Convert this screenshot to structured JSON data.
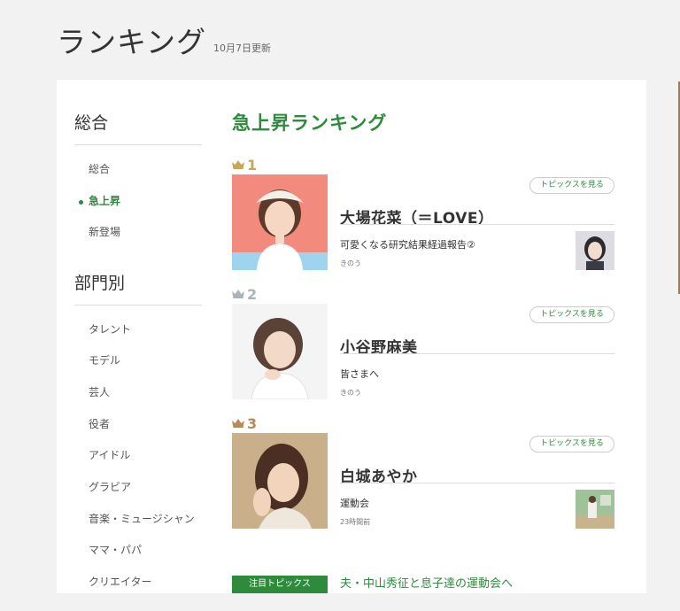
{
  "header": {
    "title": "ランキング",
    "updated": "10月7日更新"
  },
  "sidebar": {
    "overall_heading": "総合",
    "overall_items": [
      {
        "label": "総合",
        "active": false
      },
      {
        "label": "急上昇",
        "active": true
      },
      {
        "label": "新登場",
        "active": false
      }
    ],
    "category_heading": "部門別",
    "category_items": [
      {
        "label": "タレント"
      },
      {
        "label": "モデル"
      },
      {
        "label": "芸人"
      },
      {
        "label": "役者"
      },
      {
        "label": "アイドル"
      },
      {
        "label": "グラビア"
      },
      {
        "label": "音楽・ミュージシャン"
      },
      {
        "label": "ママ・パパ"
      },
      {
        "label": "クリエイター"
      }
    ]
  },
  "main": {
    "title": "急上昇ランキング",
    "topics_button_label": "トピックスを見る",
    "entries": [
      {
        "rank": "1",
        "crown_color": "#c9a55a",
        "name": "大場花菜（＝LOVE）",
        "topic": "可愛くなる研究結果経過報告②",
        "time": "きのう",
        "has_thumb": true
      },
      {
        "rank": "2",
        "crown_color": "#a9b4ba",
        "name": "小谷野麻美",
        "topic": "皆さまへ",
        "time": "きのう",
        "has_thumb": false
      },
      {
        "rank": "3",
        "crown_color": "#b88a5a",
        "name": "白城あやか",
        "topic": "運動会",
        "time": "23時間前",
        "has_thumb": true
      }
    ],
    "featured": {
      "tag": "注目トピックス",
      "text": "夫・中山秀征と息子達の運動会へ"
    }
  },
  "colors": {
    "accent": "#2e8b3c",
    "background": "#f2f2f2",
    "card": "#ffffff"
  }
}
